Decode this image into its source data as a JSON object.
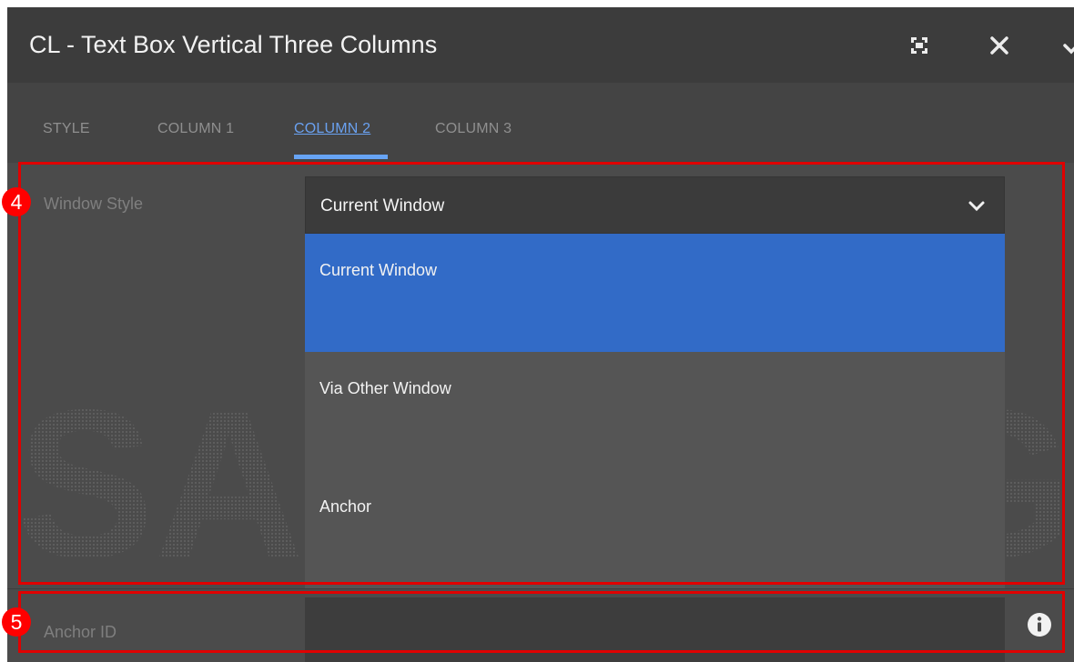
{
  "dialog": {
    "title": "CL - Text Box Vertical Three Columns",
    "header_buttons": [
      "fullscreen-icon",
      "close-icon",
      "checkmark-icon"
    ]
  },
  "tabs": [
    {
      "label": "STYLE",
      "active": false
    },
    {
      "label": "COLUMN 1",
      "active": false
    },
    {
      "label": "COLUMN 2",
      "active": true
    },
    {
      "label": "COLUMN 3",
      "active": false
    }
  ],
  "fields": {
    "window_style": {
      "label": "Window Style",
      "value": "Current Window",
      "options": [
        "Current Window",
        "Via Other Window",
        "Anchor"
      ],
      "selected_option": "Current Window"
    },
    "anchor_id": {
      "label": "Anchor ID",
      "value": ""
    }
  },
  "watermark": {
    "text": "SAMSUNG"
  },
  "annotations": [
    {
      "number": "4"
    },
    {
      "number": "5"
    }
  ],
  "colors": {
    "accent": "#67a4f5",
    "selected_option": "#326bc7",
    "annotation": "#ff0000"
  }
}
